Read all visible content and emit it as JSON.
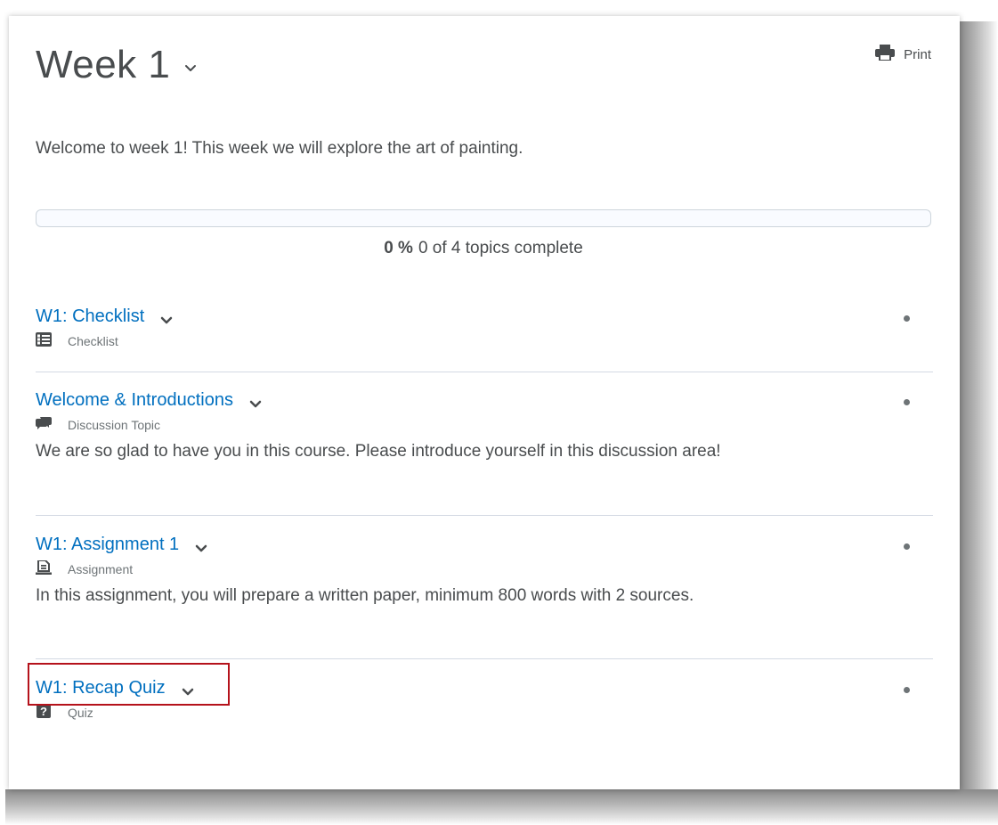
{
  "module": {
    "title": "Week 1",
    "print_label": "Print",
    "intro": "Welcome to week 1! This week we will explore the art of painting."
  },
  "progress": {
    "percent_value": 0,
    "percent_label": "0 %",
    "summary": "0 of 4 topics complete",
    "fill_color": "#006fbf"
  },
  "topics": [
    {
      "title": "W1: Checklist",
      "type": "Checklist",
      "icon": "checklist-icon",
      "description": ""
    },
    {
      "title": "Welcome & Introductions",
      "type": "Discussion Topic",
      "icon": "discussion-icon",
      "description": "We are so glad to have you in this course. Please introduce yourself in this discussion area!"
    },
    {
      "title": "W1: Assignment 1",
      "type": "Assignment",
      "icon": "assignment-icon",
      "description": "In this assignment, you will prepare a written paper, minimum 800 words with 2 sources."
    },
    {
      "title": "W1: Recap Quiz",
      "type": "Quiz",
      "icon": "quiz-icon",
      "description": ""
    }
  ],
  "colors": {
    "link": "#006fbf",
    "text": "#494c4e",
    "highlight_border": "#b5121b"
  }
}
